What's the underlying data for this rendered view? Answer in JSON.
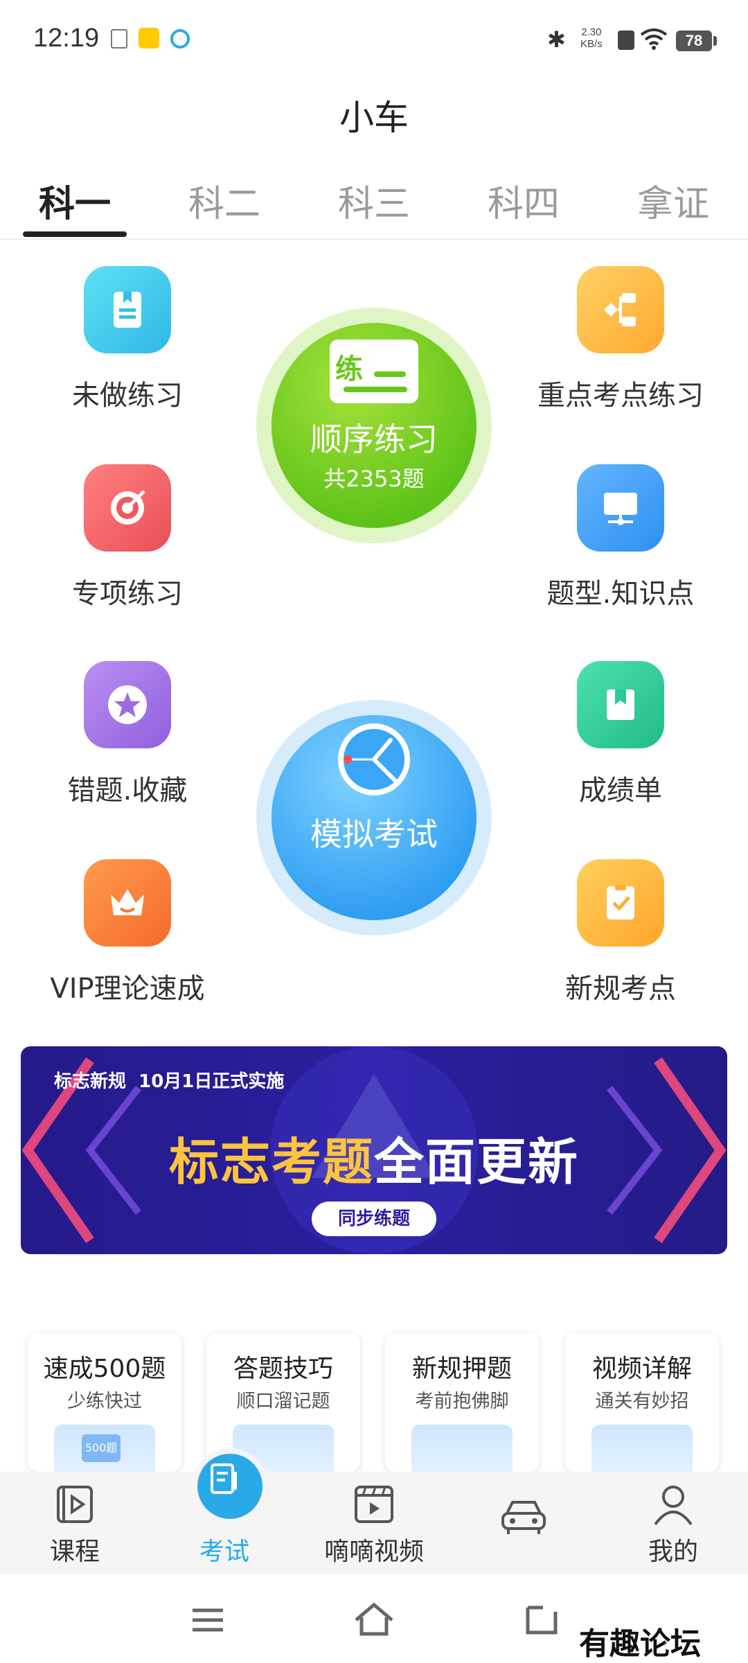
{
  "status_bar": {
    "time": "12:19",
    "net_speed_value": "2.30",
    "net_speed_unit": "KB/s",
    "battery": "78"
  },
  "header": {
    "title": "小车"
  },
  "tabs": [
    {
      "label": "科一",
      "active": true
    },
    {
      "label": "科二",
      "active": false
    },
    {
      "label": "科三",
      "active": false
    },
    {
      "label": "科四",
      "active": false
    },
    {
      "label": "拿证",
      "active": false
    }
  ],
  "features": {
    "left": [
      {
        "label": "未做练习",
        "icon": "book-icon",
        "color": "#3dc9ec"
      },
      {
        "label": "专项练习",
        "icon": "target-icon",
        "color": "#f05a5a"
      },
      {
        "label": "错题.收藏",
        "icon": "star-icon",
        "color": "#a374e6"
      },
      {
        "label": "VIP理论速成",
        "icon": "crown-icon",
        "color": "#ff7a3d"
      }
    ],
    "right": [
      {
        "label": "重点考点练习",
        "icon": "branch-icon",
        "color": "#ffb93a"
      },
      {
        "label": "题型.知识点",
        "icon": "monitor-icon",
        "color": "#3b9bf2"
      },
      {
        "label": "成绩单",
        "icon": "bookmark-icon",
        "color": "#2ec99a"
      },
      {
        "label": "新规考点",
        "icon": "checklist-icon",
        "color": "#ffb23c"
      }
    ]
  },
  "sequence_practice": {
    "badge": "练",
    "label": "顺序练习",
    "count_text": "共2353题"
  },
  "mock_exam": {
    "label": "模拟考试"
  },
  "banner": {
    "top_prefix": "标志新规",
    "top_highlight": "10月1日正式实施",
    "main_a": "标志考题",
    "main_b": "全面更新",
    "button": "同步练题"
  },
  "cards": [
    {
      "title": "速成500题",
      "subtitle": "少练快过",
      "image_text": "500题"
    },
    {
      "title": "答题技巧",
      "subtitle": "顺口溜记题"
    },
    {
      "title": "新规押题",
      "subtitle": "考前抱佛脚"
    },
    {
      "title": "视频详解",
      "subtitle": "通关有妙招"
    }
  ],
  "bottom_nav": [
    {
      "label": "课程",
      "icon": "play-book-icon"
    },
    {
      "label": "考试",
      "icon": "exam-icon",
      "active": true
    },
    {
      "label": "嘀嘀视频",
      "icon": "video-icon"
    },
    {
      "label": "",
      "icon": "car-icon"
    },
    {
      "label": "我的",
      "icon": "person-icon"
    }
  ],
  "watermark": "有趣论坛",
  "colors": {
    "accent": "#2aa9e8",
    "green": "#5cc218",
    "blue": "#2f9df2"
  }
}
